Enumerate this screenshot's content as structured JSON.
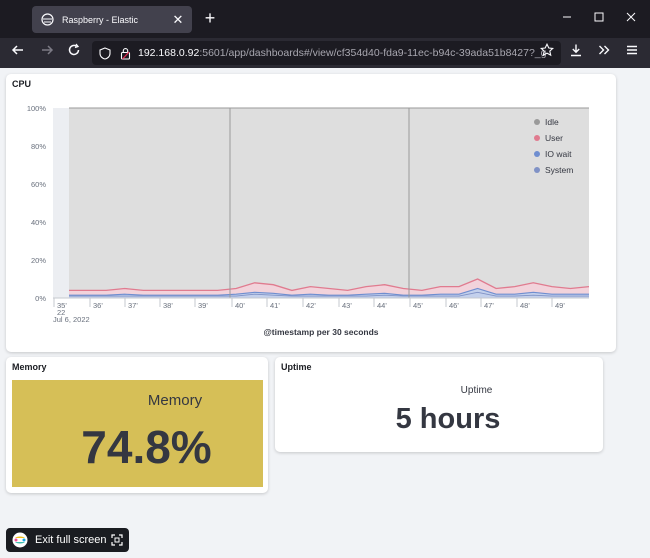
{
  "browser": {
    "tab_title": "Raspberry - Elastic",
    "tab_close": "✕",
    "new_tab": "+",
    "url_host": "192.168.0.92",
    "url_rest": ":5601/app/dashboards#/view/cf354d40-fda9-11ec-b94c-39ada51b8427?_g",
    "icons": [
      "back-icon",
      "forward-icon",
      "reload-icon",
      "shield-icon",
      "lock-icon",
      "bookmark-icon",
      "download-icon",
      "overflow-icon",
      "menu-icon"
    ]
  },
  "panels": {
    "cpu_title": "CPU",
    "memory_title": "Memory",
    "uptime_title": "Uptime"
  },
  "memory": {
    "label": "Memory",
    "value": "74.8%",
    "color": "#d6bf57"
  },
  "uptime": {
    "label": "Uptime",
    "value": "5 hours"
  },
  "exit_fullscreen": {
    "label": "Exit full screen"
  },
  "chart_data": {
    "type": "area",
    "title": "CPU",
    "xlabel": "@timestamp per 30 seconds",
    "ylabel": "",
    "ylim": [
      0,
      100
    ],
    "y_ticks": [
      "0%",
      "20%",
      "40%",
      "60%",
      "80%",
      "100%"
    ],
    "x_ticks": [
      "35'",
      "36'",
      "37'",
      "38'",
      "39'",
      "40'",
      "41'",
      "42'",
      "43'",
      "44'",
      "45'",
      "46'",
      "47'",
      "48'",
      "49'"
    ],
    "x_subtick": "22",
    "x_date": "Jul 6, 2022",
    "legend_position": "top-right",
    "series": [
      {
        "name": "Idle",
        "color": "#9a9a9a",
        "values": [
          96,
          96,
          96,
          96,
          96,
          96,
          96,
          96,
          96,
          96,
          96,
          96,
          96,
          96,
          96,
          96,
          96,
          96,
          96,
          96,
          96,
          96,
          96,
          96,
          96,
          96,
          96,
          96,
          96
        ]
      },
      {
        "name": "User",
        "color": "#e07b8f",
        "values": [
          4,
          4,
          4,
          5,
          4,
          4,
          4,
          4,
          4,
          5,
          8,
          7,
          4,
          6,
          5,
          4,
          6,
          7,
          5,
          4,
          6,
          6,
          10,
          5,
          6,
          8,
          6,
          5,
          6
        ]
      },
      {
        "name": "IO wait",
        "color": "#6f8ed0",
        "values": [
          1.5,
          1.5,
          1.5,
          2,
          1.5,
          1.5,
          1.5,
          1.5,
          1.5,
          2,
          3,
          2.5,
          1.5,
          2,
          1.5,
          1.5,
          2,
          2.5,
          1.5,
          1.5,
          2,
          2,
          5,
          2,
          2,
          3,
          2,
          2,
          2
        ]
      },
      {
        "name": "System",
        "color": "#8092c6",
        "values": [
          1,
          1,
          1,
          1,
          1,
          1,
          1,
          1,
          1,
          1,
          2,
          1.5,
          1,
          1,
          1,
          1,
          1,
          1.5,
          1,
          1,
          1,
          1,
          3,
          1,
          1,
          1.5,
          1,
          1,
          1
        ]
      }
    ]
  }
}
